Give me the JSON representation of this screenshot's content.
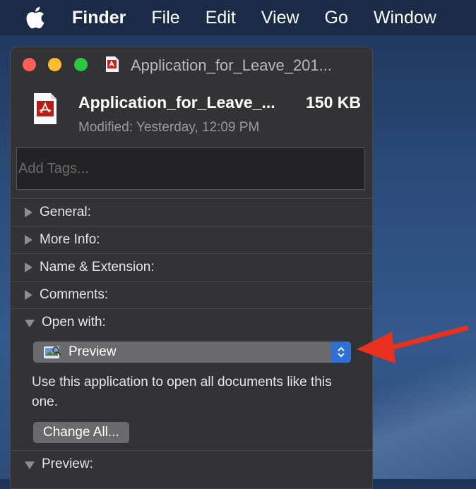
{
  "menubar": {
    "items": [
      "Finder",
      "File",
      "Edit",
      "View",
      "Go",
      "Window"
    ]
  },
  "window": {
    "title": "Application_for_Leave_201...",
    "file_name": "Application_for_Leave_...",
    "file_size": "150 KB",
    "modified": "Modified: Yesterday, 12:09 PM",
    "tags_placeholder": "Add Tags..."
  },
  "sections": {
    "general": "General:",
    "more_info": "More Info:",
    "name_ext": "Name & Extension:",
    "comments": "Comments:",
    "open_with": "Open with:",
    "preview": "Preview:"
  },
  "open_with": {
    "app": "Preview",
    "helper": "Use this application to open all documents like this one.",
    "change_all": "Change All..."
  },
  "colors": {
    "arrow": "#e8321f",
    "accent": "#2f6fd6"
  }
}
